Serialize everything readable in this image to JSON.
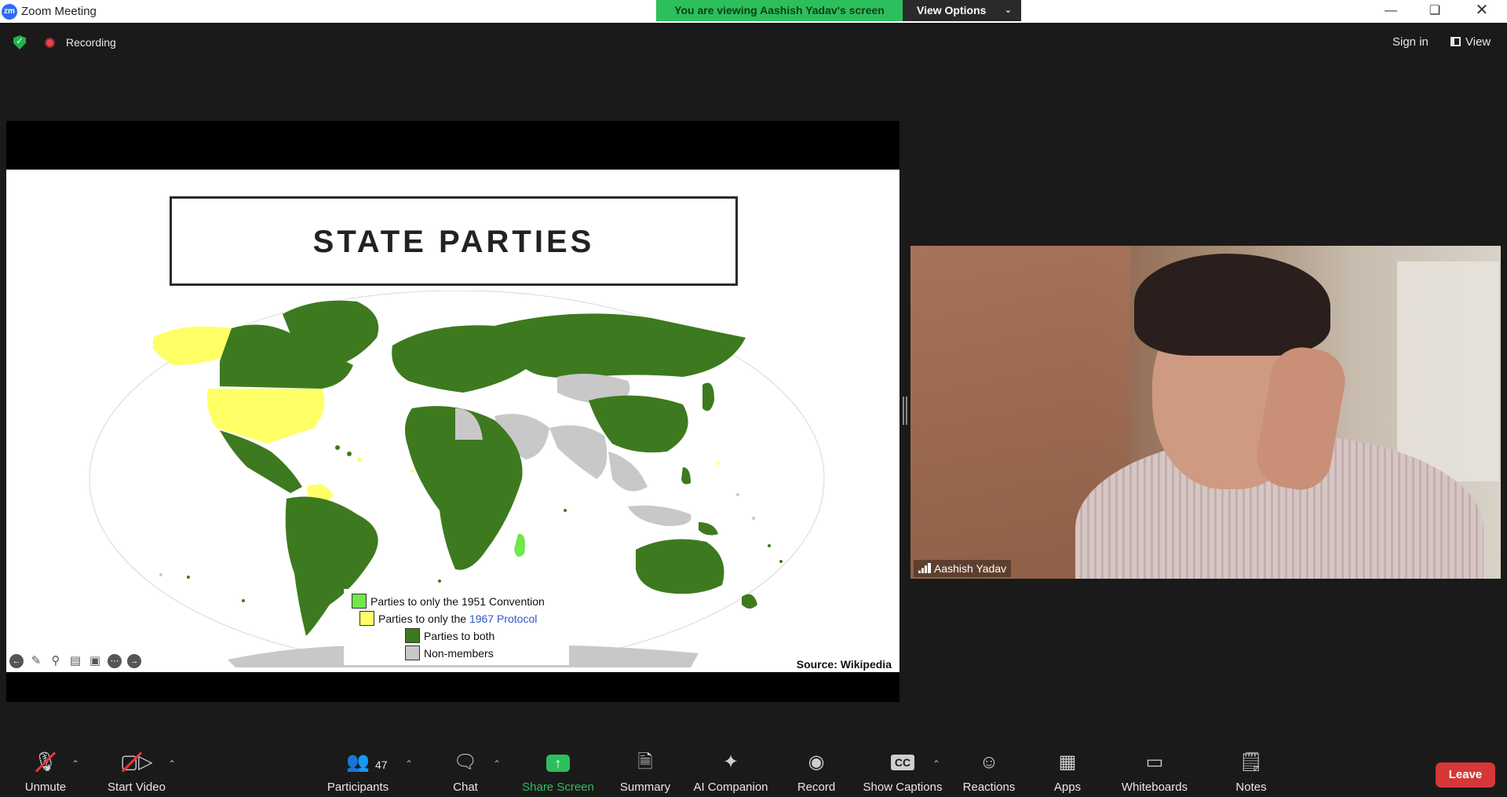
{
  "window": {
    "app_logo": "zm",
    "title": "Zoom Meeting",
    "viewing_banner": "You are viewing Aashish Yadav's screen",
    "view_options": "View Options",
    "controls": [
      "minimize",
      "restore",
      "close"
    ]
  },
  "topbar": {
    "recording_label": "Recording",
    "sign_in": "Sign in",
    "view_label": "View"
  },
  "slide": {
    "title": "STATE PARTIES",
    "legend": [
      {
        "label": "Parties to only the 1951 Convention",
        "color": "#6ee84a"
      },
      {
        "label": "Parties to only the ",
        "link": "1967 Protocol",
        "color": "#ffff66"
      },
      {
        "label": "Parties to both",
        "color": "#3d7a1f"
      },
      {
        "label": "Non-members",
        "color": "#c8c8c8"
      }
    ],
    "source": "Source: Wikipedia"
  },
  "video": {
    "participant_name": "Aashish Yadav"
  },
  "toolbar": {
    "unmute": "Unmute",
    "start_video": "Start Video",
    "participants": "Participants",
    "participants_count": "47",
    "chat": "Chat",
    "share_screen": "Share Screen",
    "summary": "Summary",
    "ai_companion": "AI Companion",
    "record": "Record",
    "show_captions": "Show Captions",
    "reactions": "Reactions",
    "apps": "Apps",
    "whiteboards": "Whiteboards",
    "notes": "Notes",
    "leave": "Leave"
  },
  "colors": {
    "share_green": "#2dbf5b",
    "leave_red": "#d63737",
    "background": "#1a1a1a"
  }
}
